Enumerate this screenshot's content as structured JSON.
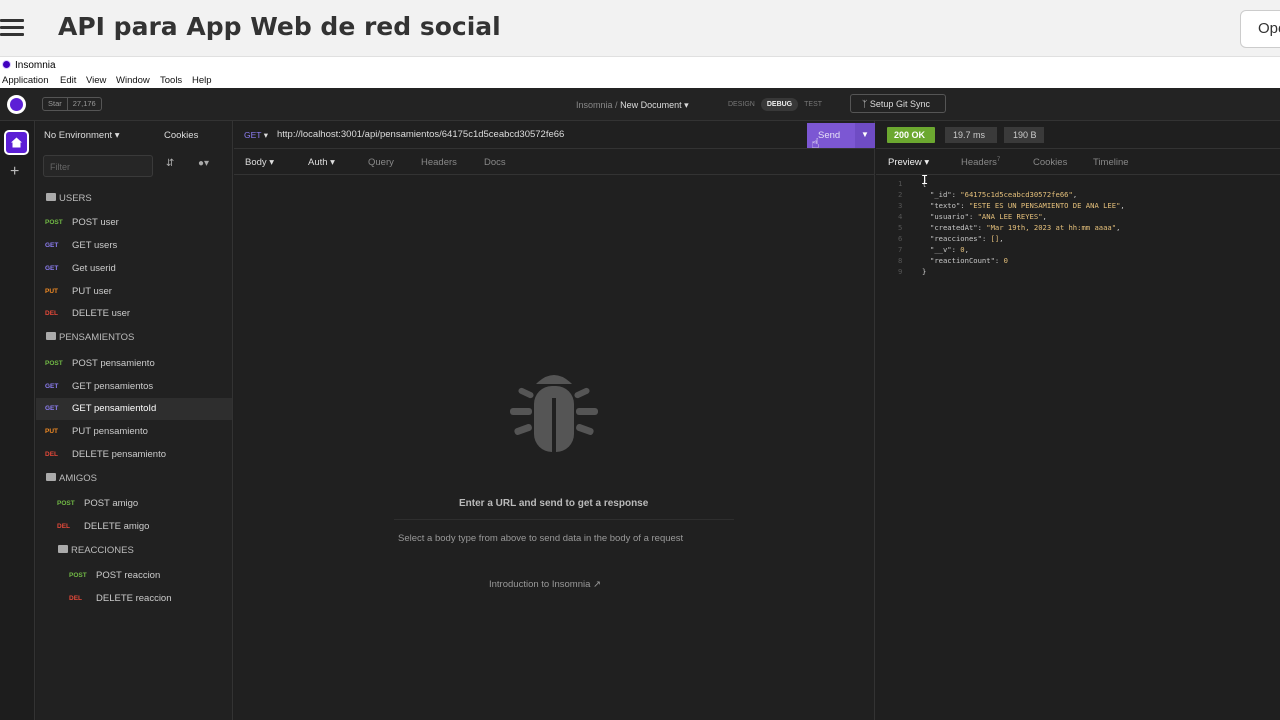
{
  "page": {
    "title": "API para App Web de red social",
    "open_button": "Ope"
  },
  "window": {
    "title": "Insomnia",
    "menu": [
      "Application",
      "Edit",
      "View",
      "Window",
      "Tools",
      "Help"
    ]
  },
  "appbar": {
    "star_label": "Star",
    "star_count": "27,176",
    "breadcrumb_root": "Insomnia",
    "breadcrumb_sep": "/",
    "document": "New Document",
    "modes": [
      "DESIGN",
      "DEBUG",
      "TEST"
    ],
    "active_mode": "DEBUG",
    "git_sync": "Setup Git Sync"
  },
  "sidebar": {
    "environment": "No Environment",
    "cookies": "Cookies",
    "filter_placeholder": "Filter",
    "items": [
      {
        "type": "folder",
        "label": "USERS"
      },
      {
        "type": "request",
        "method": "POST",
        "label": "POST user"
      },
      {
        "type": "request",
        "method": "GET",
        "label": "GET users"
      },
      {
        "type": "request",
        "method": "GET",
        "label": "Get userid"
      },
      {
        "type": "request",
        "method": "PUT",
        "label": "PUT user"
      },
      {
        "type": "request",
        "method": "DEL",
        "label": "DELETE user"
      },
      {
        "type": "folder",
        "label": "PENSAMIENTOS"
      },
      {
        "type": "request",
        "method": "POST",
        "label": "POST pensamiento"
      },
      {
        "type": "request",
        "method": "GET",
        "label": "GET pensamientos"
      },
      {
        "type": "request",
        "method": "GET",
        "label": "GET pensamientoId",
        "selected": true
      },
      {
        "type": "request",
        "method": "PUT",
        "label": "PUT pensamiento"
      },
      {
        "type": "request",
        "method": "DEL",
        "label": "DELETE pensamiento"
      },
      {
        "type": "folder",
        "label": "AMIGOS"
      },
      {
        "type": "request",
        "method": "POST",
        "label": "POST amigo"
      },
      {
        "type": "request",
        "method": "DEL",
        "label": "DELETE amigo"
      },
      {
        "type": "folder",
        "label": "REACCIONES"
      },
      {
        "type": "request",
        "method": "POST",
        "label": "POST reaccion"
      },
      {
        "type": "request",
        "method": "DEL",
        "label": "DELETE reaccion"
      }
    ]
  },
  "request": {
    "method": "GET",
    "url": "http://localhost:3001/api/pensamientos/64175c1d5ceabcd30572fe66",
    "send": "Send",
    "tabs": [
      "Body",
      "Auth",
      "Query",
      "Headers",
      "Docs"
    ],
    "empty_title": "Enter a URL and send to get a response",
    "empty_sub": "Select a body type from above to send data in the body of a request",
    "intro_link": "Introduction to Insomnia"
  },
  "response": {
    "status": "200 OK",
    "time": "19.7 ms",
    "size": "190 B",
    "tabs": [
      "Preview",
      "Headers",
      "Cookies",
      "Timeline"
    ],
    "headers_count": "7",
    "lines": [
      {
        "n": "1",
        "text": "{"
      },
      {
        "n": "2",
        "key": "\"_id\"",
        "val": "\"64175c1d5ceabcd30572fe66\"",
        "end": ","
      },
      {
        "n": "3",
        "key": "\"texto\"",
        "val": "\"ESTE ES UN PENSAMIENTO DE ANA LEE\"",
        "end": ","
      },
      {
        "n": "4",
        "key": "\"usuario\"",
        "val": "\"ANA LEE REYES\"",
        "end": ","
      },
      {
        "n": "5",
        "key": "\"createdAt\"",
        "val": "\"Mar 19th, 2023 at hh:mm aaaa\"",
        "end": ","
      },
      {
        "n": "6",
        "key": "\"reacciones\"",
        "val": "[]",
        "end": ","
      },
      {
        "n": "7",
        "key": "\"__v\"",
        "val": "0",
        "end": ","
      },
      {
        "n": "8",
        "key": "\"reactionCount\"",
        "val": "0",
        "end": ""
      },
      {
        "n": "9",
        "text": "}"
      }
    ]
  },
  "colors": {
    "accent": "#7c57d3",
    "status_ok": "#6ca830",
    "post": "#71b945",
    "get": "#8d7ef3",
    "put": "#f08a24",
    "delete": "#e5493a"
  }
}
